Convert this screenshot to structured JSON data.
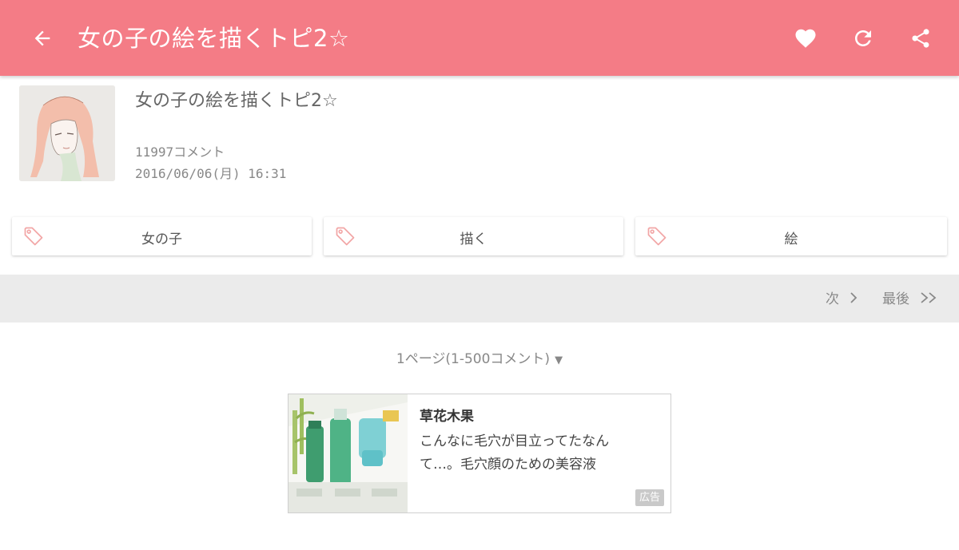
{
  "appbar": {
    "title": "女の子の絵を描くトピ2☆",
    "color": "#f47c86",
    "icons": [
      "back-arrow-icon",
      "heart-icon",
      "refresh-icon",
      "share-icon"
    ]
  },
  "topic": {
    "title": "女の子の絵を描くトピ2☆",
    "comments": "11997コメント",
    "date": "2016/06/06(月) 16:31"
  },
  "tags": [
    {
      "label": "女の子",
      "icon": "tag-icon"
    },
    {
      "label": "描く",
      "icon": "tag-icon"
    },
    {
      "label": "絵",
      "icon": "tag-icon"
    }
  ],
  "pager": {
    "next": "次",
    "last": "最後"
  },
  "page_select": {
    "label": "1ページ(1-500コメント)"
  },
  "ad": {
    "brand": "草花木果",
    "copy": "こんなに毛穴が目立ってたなんて…。毛穴顔のための美容液",
    "badge": "広告"
  }
}
